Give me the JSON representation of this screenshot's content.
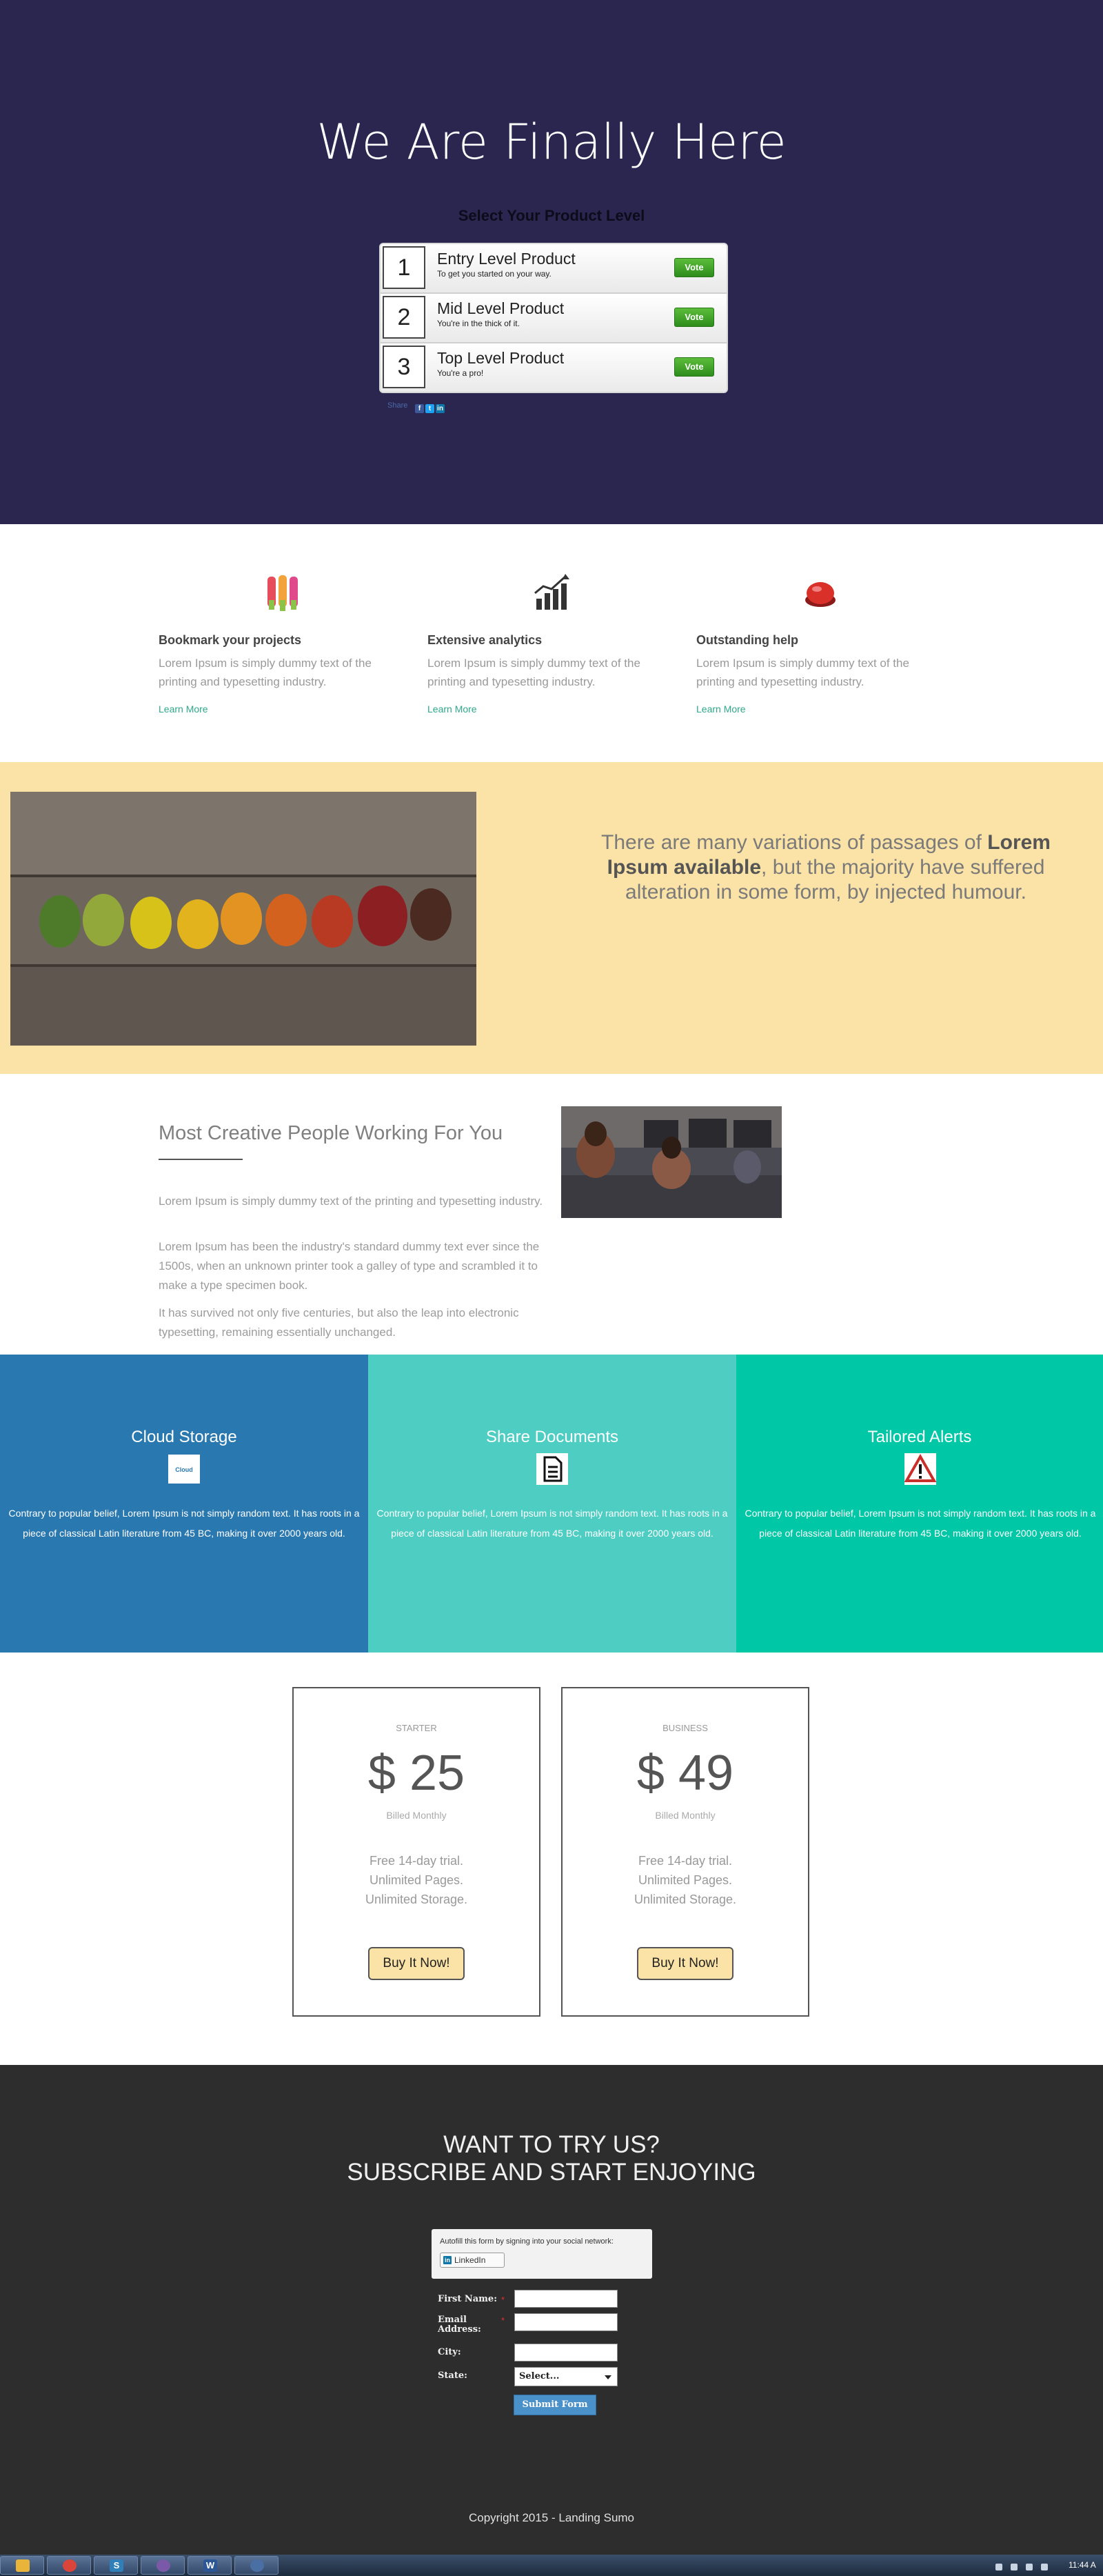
{
  "hero": {
    "title": "We Are Finally Here",
    "subtitle": "Select Your Product Level",
    "products": [
      {
        "number": "1",
        "name": "Entry Level Product",
        "desc": "To get you started on your way.",
        "vote_label": "Vote"
      },
      {
        "number": "2",
        "name": "Mid Level Product",
        "desc": "You're in the thick of it.",
        "vote_label": "Vote"
      },
      {
        "number": "3",
        "name": "Top Level Product",
        "desc": "You're a pro!",
        "vote_label": "Vote"
      }
    ],
    "share_label": "Share",
    "share_icons": [
      "facebook-icon",
      "twitter-icon",
      "linkedin-icon"
    ]
  },
  "features": [
    {
      "icon": "bookmark-icon",
      "title": "Bookmark your projects",
      "text": "Lorem Ipsum is simply dummy text of the printing and typesetting industry.",
      "link": "Learn More"
    },
    {
      "icon": "analytics-icon",
      "title": "Extensive analytics",
      "text": "Lorem Ipsum is simply dummy text of the printing and typesetting industry.",
      "link": "Learn More"
    },
    {
      "icon": "help-icon",
      "title": "Outstanding help",
      "text": "Lorem Ipsum is simply dummy text of the printing and typesetting industry.",
      "link": "Learn More"
    }
  ],
  "band": {
    "text_before": "There are many variations of passages of ",
    "text_bold": "Lorem Ipsum available",
    "text_after": ", but the majority have suffered alteration in some form, by injected humour."
  },
  "creative": {
    "title": "Most Creative People Working For You",
    "paragraphs": [
      "Lorem Ipsum is simply dummy text of the printing and typesetting industry.",
      "Lorem Ipsum has been the industry's standard dummy text ever since the 1500s, when an unknown printer took a galley of type and scrambled it to make a type specimen book.",
      "It has survived not only five centuries, but also the leap into electronic typesetting, remaining essentially unchanged."
    ]
  },
  "services": [
    {
      "title": "Cloud Storage",
      "icon": "cloud-icon",
      "icon_label": "Cloud",
      "text": "Contrary to popular belief, Lorem Ipsum is not simply random text. It has roots in a piece of classical Latin literature from 45 BC, making it over 2000 years old.",
      "color": "#2a78b0"
    },
    {
      "title": "Share Documents",
      "icon": "document-icon",
      "text": "Contrary to popular belief, Lorem Ipsum is not simply random text. It has roots in a piece of classical Latin literature from 45 BC, making it over 2000 years old.",
      "color": "#4ecdc3"
    },
    {
      "title": "Tailored Alerts",
      "icon": "warning-icon",
      "text": "Contrary to popular belief, Lorem Ipsum is not simply random text. It has roots in a piece of classical Latin literature from 45 BC, making it over 2000 years old.",
      "color": "#00c7a5"
    }
  ],
  "pricing": [
    {
      "plan": "STARTER",
      "price": "$ 25",
      "billing": "Billed Monthly",
      "features": [
        "Free 14-day trial.",
        "Unlimited Pages.",
        "Unlimited Storage."
      ],
      "button": "Buy It Now!"
    },
    {
      "plan": "BUSINESS",
      "price": "$ 49",
      "billing": "Billed Monthly",
      "features": [
        "Free 14-day trial.",
        "Unlimited Pages.",
        "Unlimited Storage."
      ],
      "button": "Buy It Now!"
    }
  ],
  "subscribe": {
    "heading1": "WANT TO TRY US?",
    "heading2": "SUBSCRIBE AND START ENJOYING",
    "social_note": "Autofill this form by signing into your social network:",
    "linkedin_label": "LinkedIn",
    "fields": {
      "first_name": "First Name:",
      "email": "Email Address:",
      "city": "City:",
      "state": "State:"
    },
    "required_mark": "*",
    "state_select": "Select...",
    "submit_label": "Submit Form"
  },
  "footer": {
    "copyright": "Copyright 2015 - Landing Sumo"
  },
  "taskbar": {
    "apps": [
      "explorer-icon",
      "chrome-icon",
      "sumo-icon",
      "ie-icon",
      "word-icon",
      "network-icon"
    ],
    "clock": "11:44 A"
  }
}
